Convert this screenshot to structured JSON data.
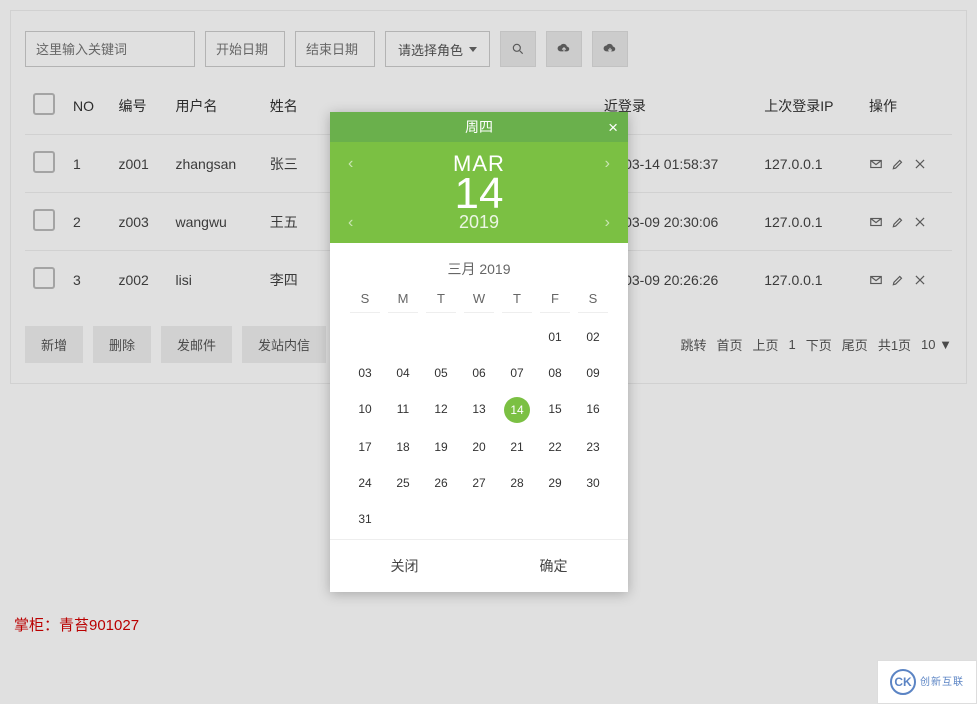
{
  "toolbar": {
    "keyword_placeholder": "这里输入关键词",
    "start_date_placeholder": "开始日期",
    "end_date_placeholder": "结束日期",
    "role_select_label": "请选择角色"
  },
  "table": {
    "headers": {
      "no": "NO",
      "code": "编号",
      "username": "用户名",
      "realname": "姓名",
      "last_login": "近登录",
      "last_ip": "上次登录IP",
      "actions": "操作"
    },
    "rows": [
      {
        "no": "1",
        "code": "z001",
        "username": "zhangsan",
        "realname": "张三",
        "last_login": "19-03-14 01:58:37",
        "last_ip": "127.0.0.1"
      },
      {
        "no": "2",
        "code": "z003",
        "username": "wangwu",
        "realname": "王五",
        "last_login": "19-03-09 20:30:06",
        "last_ip": "127.0.0.1"
      },
      {
        "no": "3",
        "code": "z002",
        "username": "lisi",
        "realname": "李四",
        "last_login": "19-03-09 20:26:26",
        "last_ip": "127.0.0.1"
      }
    ]
  },
  "buttons": {
    "add": "新增",
    "delete": "删除",
    "send_mail": "发邮件",
    "send_msg": "发站内信"
  },
  "pagination": {
    "jump": "跳转",
    "first": "首页",
    "prev": "上页",
    "current": "1",
    "next": "下页",
    "last": "尾页",
    "total": "共1页",
    "page_size": "10 ▼"
  },
  "datepicker": {
    "weekday": "周四",
    "month_abbr": "MAR",
    "day": "14",
    "year": "2019",
    "month_full": "三月 2019",
    "dow": [
      "S",
      "M",
      "T",
      "W",
      "T",
      "F",
      "S"
    ],
    "weeks": [
      [
        "",
        "",
        "",
        "",
        "",
        "01",
        "02"
      ],
      [
        "03",
        "04",
        "05",
        "06",
        "07",
        "08",
        "09"
      ],
      [
        "10",
        "11",
        "12",
        "13",
        "14",
        "15",
        "16"
      ],
      [
        "17",
        "18",
        "19",
        "20",
        "21",
        "22",
        "23"
      ],
      [
        "24",
        "25",
        "26",
        "27",
        "28",
        "29",
        "30"
      ],
      [
        "31",
        "",
        "",
        "",
        "",
        "",
        ""
      ]
    ],
    "selected": "14",
    "close": "关闭",
    "confirm": "确定"
  },
  "footer": "掌柜：青苔901027",
  "logo": {
    "mark": "CK",
    "text": "创新互联"
  }
}
